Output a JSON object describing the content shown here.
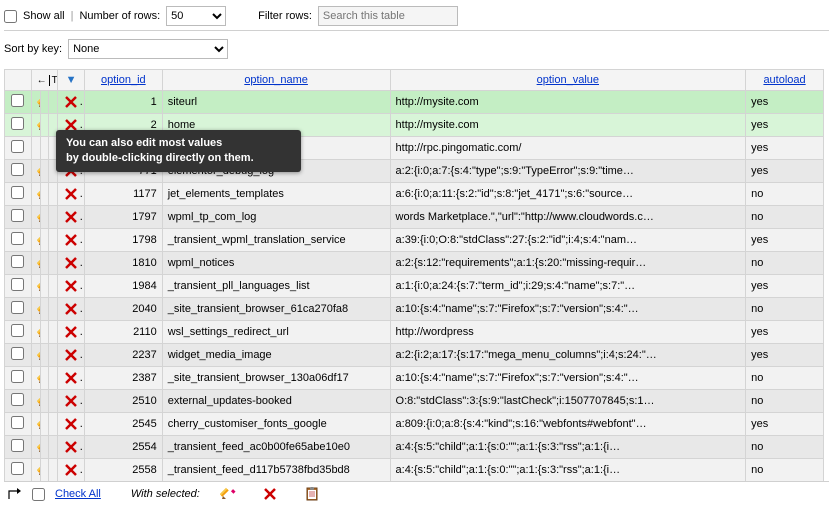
{
  "controls": {
    "show_all": "Show all",
    "num_rows_label": "Number of rows:",
    "num_rows_value": "50",
    "filter_label": "Filter rows:",
    "filter_placeholder": "Search this table",
    "sort_label": "Sort by key:",
    "sort_value": "None"
  },
  "headers": {
    "option_id": "option_id",
    "option_name": "option_name",
    "option_value": "option_value",
    "autoload": "autoload"
  },
  "tooltip": {
    "line1": "You can also edit most values",
    "line2": "by double-clicking directly on them."
  },
  "rows": [
    {
      "id": "1",
      "name": "siteurl",
      "value": "http://mysite.com",
      "autoload": "yes",
      "sel": 1
    },
    {
      "id": "2",
      "name": "home",
      "value": "http://mysite.com",
      "autoload": "yes",
      "sel": 2
    },
    {
      "id": "",
      "name": "",
      "value": "http://rpc.pingomatic.com/",
      "autoload": "yes",
      "sel": 0,
      "blank_actions": true
    },
    {
      "id": "771",
      "name": "elementor_debug_log",
      "value": "a:2:{i:0;a:7:{s:4:\"type\";s:9:\"TypeError\";s:9:\"time…",
      "autoload": "yes",
      "sel": 0
    },
    {
      "id": "1177",
      "name": "jet_elements_templates",
      "value": "a:6:{i:0;a:11:{s:2:\"id\";s:8:\"jet_4171\";s:6:\"source…",
      "autoload": "no",
      "sel": 0
    },
    {
      "id": "1797",
      "name": "wpml_tp_com_log",
      "value": "words Marketplace.\",\"url\":\"http://www.cloudwords.c…",
      "autoload": "no",
      "sel": 0
    },
    {
      "id": "1798",
      "name": "_transient_wpml_translation_service",
      "value": "a:39:{i:0;O:8:\"stdClass\":27:{s:2:\"id\";i:4;s:4:\"nam…",
      "autoload": "yes",
      "sel": 0
    },
    {
      "id": "1810",
      "name": "wpml_notices",
      "value": "a:2:{s:12:\"requirements\";a:1:{s:20:\"missing-requir…",
      "autoload": "no",
      "sel": 0
    },
    {
      "id": "1984",
      "name": "_transient_pll_languages_list",
      "value": "a:1:{i:0;a:24:{s:7:\"term_id\";i:29;s:4:\"name\";s:7:\"…",
      "autoload": "yes",
      "sel": 0
    },
    {
      "id": "2040",
      "name": "_site_transient_browser_61ca270fa8",
      "value": "a:10:{s:4:\"name\";s:7:\"Firefox\";s:7:\"version\";s:4:\"…",
      "autoload": "no",
      "sel": 0
    },
    {
      "id": "2110",
      "name": "wsl_settings_redirect_url",
      "value": "http://wordpress",
      "autoload": "yes",
      "sel": 0
    },
    {
      "id": "2237",
      "name": "widget_media_image",
      "value": "a:2:{i:2;a:17:{s:17:\"mega_menu_columns\";i:4;s:24:\"…",
      "autoload": "yes",
      "sel": 0
    },
    {
      "id": "2387",
      "name": "_site_transient_browser_130a06df17",
      "value": "a:10:{s:4:\"name\";s:7:\"Firefox\";s:7:\"version\";s:4:\"…",
      "autoload": "no",
      "sel": 0
    },
    {
      "id": "2510",
      "name": "external_updates-booked",
      "value": "O:8:\"stdClass\":3:{s:9:\"lastCheck\";i:1507707845;s:1…",
      "autoload": "no",
      "sel": 0
    },
    {
      "id": "2545",
      "name": "cherry_customiser_fonts_google",
      "value": "a:809:{i:0;a:8:{s:4:\"kind\";s:16:\"webfonts#webfont\"…",
      "autoload": "yes",
      "sel": 0
    },
    {
      "id": "2554",
      "name": "_transient_feed_ac0b00fe65abe10e0",
      "value": "a:4:{s:5:\"child\";a:1:{s:0:\"\";a:1:{s:3:\"rss\";a:1:{i…",
      "autoload": "no",
      "sel": 0
    },
    {
      "id": "2558",
      "name": "_transient_feed_d117b5738fbd35bd8",
      "value": "a:4:{s:5:\"child\";a:1:{s:0:\"\";a:1:{s:3:\"rss\";a:1:{i…",
      "autoload": "no",
      "sel": 0
    }
  ],
  "bottom": {
    "check_all": "Check All",
    "with_selected": "With selected:"
  }
}
